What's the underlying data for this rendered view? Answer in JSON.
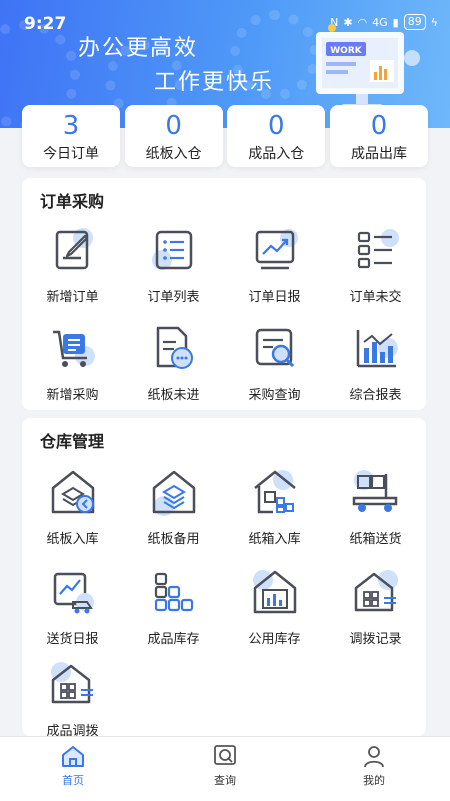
{
  "status_bar": {
    "time": "9:27",
    "signal_text": "4G",
    "battery": "89"
  },
  "banner": {
    "slogan_line1": "办公更高效",
    "slogan_line2": "工作更快乐",
    "sign_text": "WORK"
  },
  "stats": [
    {
      "value": "3",
      "label": "今日订单"
    },
    {
      "value": "0",
      "label": "纸板入仓"
    },
    {
      "value": "0",
      "label": "成品入仓"
    },
    {
      "value": "0",
      "label": "成品出库"
    }
  ],
  "sections": {
    "orders": {
      "title": "订单采购",
      "items": [
        {
          "label": "新增订单",
          "icon": "edit-document-icon"
        },
        {
          "label": "订单列表",
          "icon": "list-icon"
        },
        {
          "label": "订单日报",
          "icon": "trend-report-icon"
        },
        {
          "label": "订单未交",
          "icon": "checklist-icon"
        },
        {
          "label": "新增采购",
          "icon": "shopping-cart-icon"
        },
        {
          "label": "纸板未进",
          "icon": "document-pending-icon"
        },
        {
          "label": "采购查询",
          "icon": "document-search-icon"
        },
        {
          "label": "综合报表",
          "icon": "bar-chart-icon"
        }
      ]
    },
    "warehouse": {
      "title": "仓库管理",
      "items": [
        {
          "label": "纸板入库",
          "icon": "warehouse-in-icon"
        },
        {
          "label": "纸板备用",
          "icon": "warehouse-stack-icon"
        },
        {
          "label": "纸箱入库",
          "icon": "warehouse-boxes-icon"
        },
        {
          "label": "纸箱送货",
          "icon": "delivery-truck-icon"
        },
        {
          "label": "送货日报",
          "icon": "delivery-report-icon"
        },
        {
          "label": "成品库存",
          "icon": "inventory-blocks-icon"
        },
        {
          "label": "公用库存",
          "icon": "public-warehouse-icon"
        },
        {
          "label": "调拨记录",
          "icon": "transfer-record-icon"
        },
        {
          "label": "成品调拨",
          "icon": "product-transfer-icon"
        }
      ]
    }
  },
  "tabbar": [
    {
      "label": "首页",
      "icon": "home-icon",
      "active": true
    },
    {
      "label": "查询",
      "icon": "search-icon",
      "active": false
    },
    {
      "label": "我的",
      "icon": "user-icon",
      "active": false
    }
  ],
  "colors": {
    "accent": "#3a78e6",
    "header_start": "#3f73f5",
    "header_end": "#6fb8fb",
    "icon_dark": "#4a4f5a",
    "icon_blob": "#cfe0fb"
  }
}
